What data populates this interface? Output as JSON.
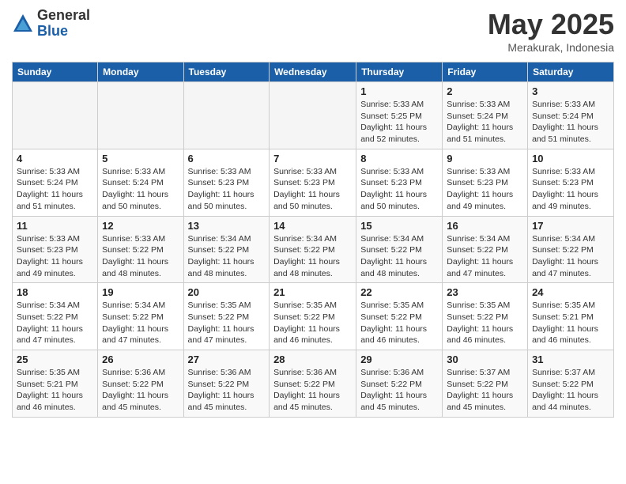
{
  "logo": {
    "general": "General",
    "blue": "Blue"
  },
  "title": "May 2025",
  "location": "Merakurak, Indonesia",
  "days_of_week": [
    "Sunday",
    "Monday",
    "Tuesday",
    "Wednesday",
    "Thursday",
    "Friday",
    "Saturday"
  ],
  "weeks": [
    [
      {
        "day": "",
        "empty": true
      },
      {
        "day": "",
        "empty": true
      },
      {
        "day": "",
        "empty": true
      },
      {
        "day": "",
        "empty": true
      },
      {
        "day": "1",
        "sunrise": "5:33 AM",
        "sunset": "5:25 PM",
        "daylight": "11 hours and 52 minutes."
      },
      {
        "day": "2",
        "sunrise": "5:33 AM",
        "sunset": "5:24 PM",
        "daylight": "11 hours and 51 minutes."
      },
      {
        "day": "3",
        "sunrise": "5:33 AM",
        "sunset": "5:24 PM",
        "daylight": "11 hours and 51 minutes."
      }
    ],
    [
      {
        "day": "4",
        "sunrise": "5:33 AM",
        "sunset": "5:24 PM",
        "daylight": "11 hours and 51 minutes."
      },
      {
        "day": "5",
        "sunrise": "5:33 AM",
        "sunset": "5:24 PM",
        "daylight": "11 hours and 50 minutes."
      },
      {
        "day": "6",
        "sunrise": "5:33 AM",
        "sunset": "5:23 PM",
        "daylight": "11 hours and 50 minutes."
      },
      {
        "day": "7",
        "sunrise": "5:33 AM",
        "sunset": "5:23 PM",
        "daylight": "11 hours and 50 minutes."
      },
      {
        "day": "8",
        "sunrise": "5:33 AM",
        "sunset": "5:23 PM",
        "daylight": "11 hours and 50 minutes."
      },
      {
        "day": "9",
        "sunrise": "5:33 AM",
        "sunset": "5:23 PM",
        "daylight": "11 hours and 49 minutes."
      },
      {
        "day": "10",
        "sunrise": "5:33 AM",
        "sunset": "5:23 PM",
        "daylight": "11 hours and 49 minutes."
      }
    ],
    [
      {
        "day": "11",
        "sunrise": "5:33 AM",
        "sunset": "5:23 PM",
        "daylight": "11 hours and 49 minutes."
      },
      {
        "day": "12",
        "sunrise": "5:33 AM",
        "sunset": "5:22 PM",
        "daylight": "11 hours and 48 minutes."
      },
      {
        "day": "13",
        "sunrise": "5:34 AM",
        "sunset": "5:22 PM",
        "daylight": "11 hours and 48 minutes."
      },
      {
        "day": "14",
        "sunrise": "5:34 AM",
        "sunset": "5:22 PM",
        "daylight": "11 hours and 48 minutes."
      },
      {
        "day": "15",
        "sunrise": "5:34 AM",
        "sunset": "5:22 PM",
        "daylight": "11 hours and 48 minutes."
      },
      {
        "day": "16",
        "sunrise": "5:34 AM",
        "sunset": "5:22 PM",
        "daylight": "11 hours and 47 minutes."
      },
      {
        "day": "17",
        "sunrise": "5:34 AM",
        "sunset": "5:22 PM",
        "daylight": "11 hours and 47 minutes."
      }
    ],
    [
      {
        "day": "18",
        "sunrise": "5:34 AM",
        "sunset": "5:22 PM",
        "daylight": "11 hours and 47 minutes."
      },
      {
        "day": "19",
        "sunrise": "5:34 AM",
        "sunset": "5:22 PM",
        "daylight": "11 hours and 47 minutes."
      },
      {
        "day": "20",
        "sunrise": "5:35 AM",
        "sunset": "5:22 PM",
        "daylight": "11 hours and 47 minutes."
      },
      {
        "day": "21",
        "sunrise": "5:35 AM",
        "sunset": "5:22 PM",
        "daylight": "11 hours and 46 minutes."
      },
      {
        "day": "22",
        "sunrise": "5:35 AM",
        "sunset": "5:22 PM",
        "daylight": "11 hours and 46 minutes."
      },
      {
        "day": "23",
        "sunrise": "5:35 AM",
        "sunset": "5:22 PM",
        "daylight": "11 hours and 46 minutes."
      },
      {
        "day": "24",
        "sunrise": "5:35 AM",
        "sunset": "5:21 PM",
        "daylight": "11 hours and 46 minutes."
      }
    ],
    [
      {
        "day": "25",
        "sunrise": "5:35 AM",
        "sunset": "5:21 PM",
        "daylight": "11 hours and 46 minutes."
      },
      {
        "day": "26",
        "sunrise": "5:36 AM",
        "sunset": "5:22 PM",
        "daylight": "11 hours and 45 minutes."
      },
      {
        "day": "27",
        "sunrise": "5:36 AM",
        "sunset": "5:22 PM",
        "daylight": "11 hours and 45 minutes."
      },
      {
        "day": "28",
        "sunrise": "5:36 AM",
        "sunset": "5:22 PM",
        "daylight": "11 hours and 45 minutes."
      },
      {
        "day": "29",
        "sunrise": "5:36 AM",
        "sunset": "5:22 PM",
        "daylight": "11 hours and 45 minutes."
      },
      {
        "day": "30",
        "sunrise": "5:37 AM",
        "sunset": "5:22 PM",
        "daylight": "11 hours and 45 minutes."
      },
      {
        "day": "31",
        "sunrise": "5:37 AM",
        "sunset": "5:22 PM",
        "daylight": "11 hours and 44 minutes."
      }
    ]
  ],
  "labels": {
    "sunrise": "Sunrise:",
    "sunset": "Sunset:",
    "daylight": "Daylight:"
  }
}
